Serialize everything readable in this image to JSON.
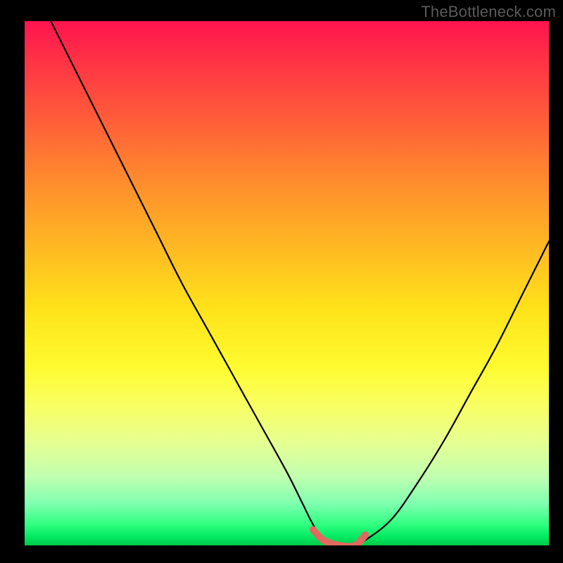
{
  "watermark": "TheBottleneck.com",
  "chart_data": {
    "type": "line",
    "title": "",
    "xlabel": "",
    "ylabel": "",
    "xlim": [
      0,
      100
    ],
    "ylim": [
      0,
      100
    ],
    "series": [
      {
        "name": "bottleneck-curve",
        "x": [
          5,
          10,
          15,
          20,
          25,
          30,
          35,
          40,
          45,
          50,
          53,
          55,
          57,
          60,
          63,
          65,
          70,
          75,
          80,
          85,
          90,
          95,
          100
        ],
        "values": [
          100,
          90,
          80,
          70,
          60,
          50,
          41,
          32,
          23,
          14,
          8,
          4,
          1,
          0,
          0,
          1,
          5,
          12,
          20,
          29,
          38,
          48,
          58
        ]
      }
    ],
    "highlight": {
      "name": "minimum-region",
      "x": [
        55,
        57,
        60,
        63,
        65
      ],
      "values": [
        3,
        1,
        0,
        0,
        2
      ],
      "color": "#e06a60"
    },
    "colors": {
      "curve": "#000000",
      "highlight": "#e06a60",
      "background_top": "#ff1450",
      "background_bottom": "#00c84a",
      "frame": "#000000",
      "watermark": "#5a5a5a"
    }
  }
}
